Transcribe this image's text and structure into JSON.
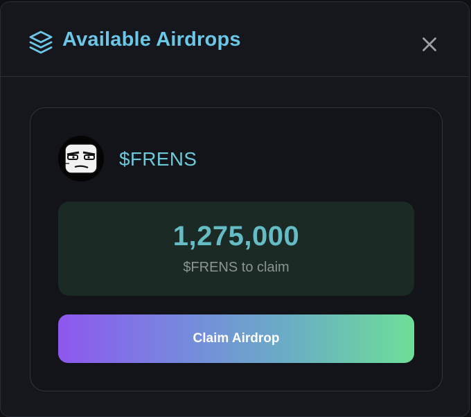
{
  "modal": {
    "title": "Available Airdrops",
    "header_icon": "layers-icon",
    "close_icon": "close-icon"
  },
  "airdrop": {
    "token": "$FRENS",
    "avatar": "frens-token-avatar",
    "amount": "1,275,000",
    "amount_label": "$FRENS to claim",
    "claim_label": "Claim Airdrop"
  },
  "colors": {
    "accent": "#6cc7e6",
    "amount_bg": "#1b2a25",
    "gradient_start": "#8e57ee",
    "gradient_end": "#6ddf98"
  }
}
